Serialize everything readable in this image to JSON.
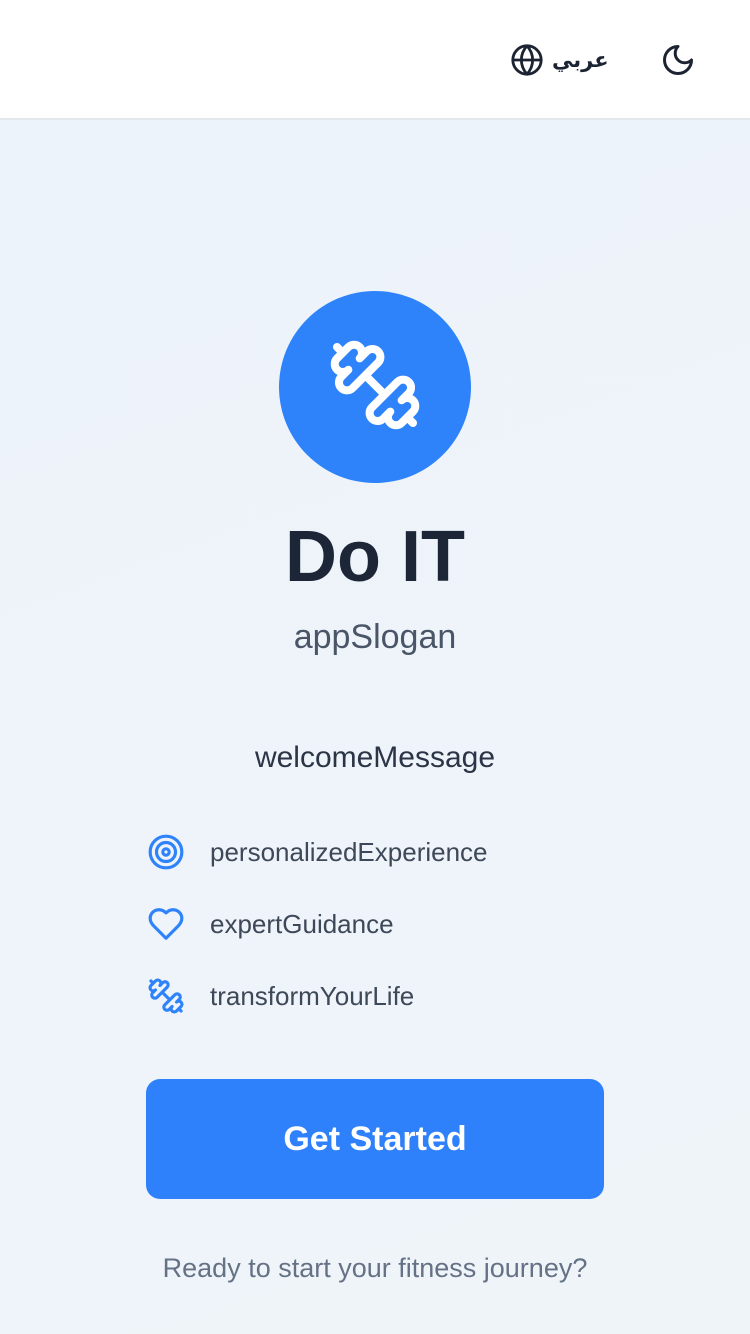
{
  "header": {
    "language_label": "عربي",
    "language_icon": "globe-icon",
    "theme_icon": "moon-icon"
  },
  "hero": {
    "logo_icon": "dumbbell-icon",
    "title": "Do IT",
    "slogan": "appSlogan",
    "welcome": "welcomeMessage"
  },
  "features": [
    {
      "icon": "target-icon",
      "label": "personalizedExperience"
    },
    {
      "icon": "heart-icon",
      "label": "expertGuidance"
    },
    {
      "icon": "dumbbell-icon",
      "label": "transformYourLife"
    }
  ],
  "cta": {
    "label": "Get Started"
  },
  "footer": {
    "text": "Ready to start your fitness journey?"
  },
  "colors": {
    "accent": "#2e83fa",
    "title": "#1c2637",
    "background": "#eef3fa"
  }
}
